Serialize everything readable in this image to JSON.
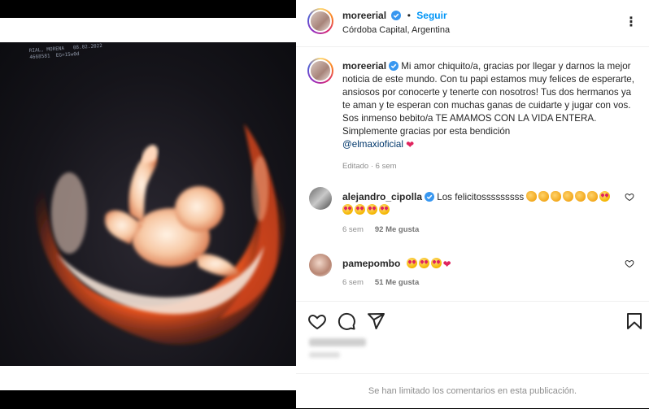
{
  "post": {
    "username": "moreerial",
    "dot": "•",
    "follow_label": "Seguir",
    "location": "Córdoba Capital, Argentina",
    "more_label": "⋮",
    "caption_user": "moreerial",
    "caption_body": "Mi amor chiquito/a, gracias por llegar y darnos la mejor noticia de este mundo. Con tu papi estamos muy felices de esperarte, ansiosos por conocerte y tenerte con nosotros! Tus dos hermanos ya te aman y te esperan con muchas ganas de cuidarte y jugar con vos. Sos inmenso bebito/a TE AMAMOS CON LA VIDA ENTERA. Simplemente gracias por esta bendición",
    "caption_mention": "@elmaxioficial",
    "edited": "Editado · 6 sem",
    "media_overlay": "RIAL, MORENA   08.02.2022\n4668581  EG=15w0d"
  },
  "comments": [
    {
      "username": "alejandro_cipolla",
      "text": "Los felicitosssssssss",
      "emojis_line1": [
        "clap",
        "clap",
        "clap",
        "clap",
        "clap",
        "clap",
        "heart-eyes"
      ],
      "emojis_line2": [
        "heart-eyes",
        "heart-eyes",
        "heart-eyes",
        "heart-eyes"
      ],
      "time": "6 sem",
      "likes": "92 Me gusta"
    },
    {
      "username": "pamepombo",
      "text": "",
      "emojis_line1": [
        "heart-eyes",
        "heart-eyes",
        "heart-eyes",
        "red-heart"
      ],
      "emojis_line2": [],
      "time": "6 sem",
      "likes": "51 Me gusta"
    }
  ],
  "footer": {
    "notice": "Se han limitado los comentarios en esta publicación."
  },
  "colors": {
    "accent": "#0095f6",
    "verified": "#3897f0",
    "mention": "#00376b",
    "muted": "#8e8e8e"
  },
  "icons": [
    "verified-badge-icon",
    "more-options-icon",
    "like-heart-icon",
    "comment-icon",
    "share-icon",
    "save-bookmark-icon",
    "comment-like-icon"
  ]
}
